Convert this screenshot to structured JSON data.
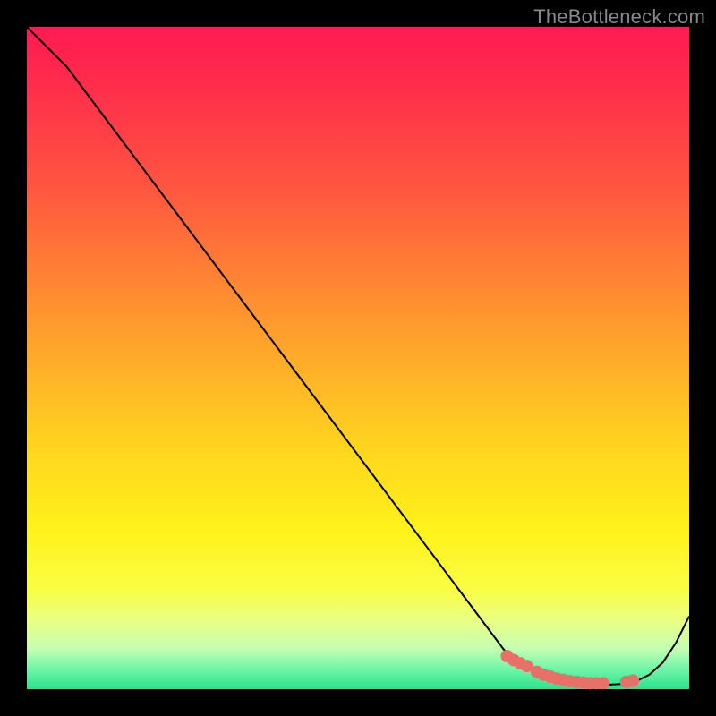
{
  "attribution": "TheBottleneck.com",
  "chart_data": {
    "type": "line",
    "title": "",
    "xlabel": "",
    "ylabel": "",
    "xlim": [
      0,
      100
    ],
    "ylim": [
      0,
      100
    ],
    "grid": false,
    "legend": false,
    "series": [
      {
        "name": "curve",
        "color": "#000000",
        "x": [
          0,
          6,
          12,
          18,
          24,
          30,
          36,
          42,
          48,
          54,
          60,
          66,
          72,
          74,
          76,
          78,
          80,
          82,
          84,
          86,
          88,
          90,
          92,
          94,
          96,
          98,
          100
        ],
        "y": [
          100,
          94,
          86,
          78,
          70,
          62,
          54,
          46,
          38,
          30,
          22,
          14,
          6,
          4,
          3,
          2,
          1.4,
          1.0,
          0.8,
          0.7,
          0.7,
          0.8,
          1.2,
          2.2,
          4.0,
          7.0,
          11.0
        ]
      }
    ],
    "markers": [
      {
        "name": "dots",
        "color": "#e77169",
        "radius": 7,
        "x": [
          72.5,
          73.5,
          74.5,
          75.5,
          77,
          78,
          79,
          80,
          81,
          82,
          83,
          84,
          85,
          86,
          87,
          90.5,
          91.5
        ],
        "y": [
          5.0,
          4.4,
          3.9,
          3.5,
          2.6,
          2.2,
          1.9,
          1.6,
          1.4,
          1.2,
          1.1,
          1.0,
          0.9,
          0.9,
          0.9,
          1.1,
          1.3
        ]
      }
    ]
  }
}
